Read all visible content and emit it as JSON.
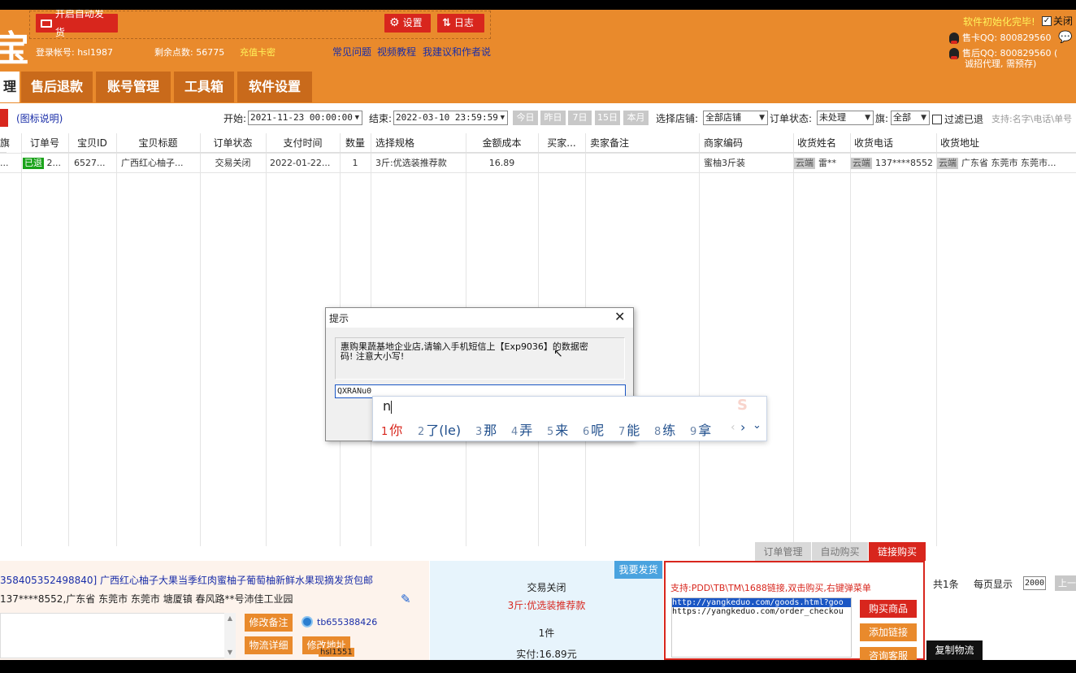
{
  "header": {
    "logo_char": "宝",
    "auto_ship_button": "开启自动发货",
    "settings_button": "设置",
    "log_button": "日志",
    "login_account": "登录帐号: hsl1987",
    "remaining_points": "剩余点数: 56775",
    "recharge_link": "充值卡密",
    "links": [
      "常见问题",
      "视频教程",
      "我建议和作者说"
    ],
    "init_done": "软件初始化完毕!",
    "close_checkbox_label": "关闭",
    "presale_qq": "售卡QQ: 800829560",
    "aftersale_qq": "售后QQ: 800829560 (",
    "aftersale_note": "诚招代理, 需预存)"
  },
  "tabs": [
    {
      "label": "理"
    },
    {
      "label": "售后退款"
    },
    {
      "label": "账号管理"
    },
    {
      "label": "工具箱"
    },
    {
      "label": "软件设置"
    }
  ],
  "filter": {
    "icon_legend": "(图标说明)",
    "start_label": "开始:",
    "start_value": "2021-11-23 00:00:00",
    "end_label": "结束:",
    "end_value": "2022-03-10 23:59:59",
    "quick_buttons": [
      "今日",
      "昨日",
      "7日",
      "15日",
      "本月"
    ],
    "shop_label": "选择店铺:",
    "shop_value": "全部店铺",
    "status_label": "订单状态:",
    "status_value": "未处理",
    "flag_label": "旗:",
    "flag_value": "全部",
    "filter_refunded_label": "过滤已退",
    "search_hint": "支持:名字\\电话\\单号"
  },
  "table": {
    "columns": [
      "旗",
      "订单号",
      "宝贝ID",
      "宝贝标题",
      "订单状态",
      "支付时间",
      "数量",
      "选择规格",
      "金额成本",
      "买家...",
      "卖家备注",
      "商家编码",
      "收货姓名",
      "收货电话",
      "收货地址"
    ],
    "rows": [
      {
        "flag": "...",
        "refund_tag": "已退",
        "order_no": "2...",
        "item_id": "6527...",
        "item_title": "广西红心柚子...",
        "status": "交易关闭",
        "pay_time": "2022-01-22...",
        "qty": "1",
        "spec": "3斤:优选装推荐款",
        "cost": "16.89",
        "buyer": "",
        "seller_note": "",
        "merchant_code": "蜜柚3斤装",
        "cloud_tag": "云端",
        "name": "雷**",
        "phone": "137****8552",
        "address": "广东省 东莞市 东莞市..."
      }
    ]
  },
  "dialog": {
    "title": "提示",
    "message_line1": "惠购果蔬基地企业店,请输入手机短信上【Exp9036】的数据密",
    "message_line2": "码! 注意大小写!",
    "input_value": "QXRANu0"
  },
  "ime": {
    "composition": "n",
    "candidates": [
      {
        "num": "1",
        "text": "你"
      },
      {
        "num": "2",
        "text": "了(le)"
      },
      {
        "num": "3",
        "text": "那"
      },
      {
        "num": "4",
        "text": "弄"
      },
      {
        "num": "5",
        "text": "来"
      },
      {
        "num": "6",
        "text": "呢"
      },
      {
        "num": "7",
        "text": "能"
      },
      {
        "num": "8",
        "text": "练"
      },
      {
        "num": "9",
        "text": "拿"
      }
    ],
    "prev": "‹",
    "next": "›",
    "expand": "⌄"
  },
  "bottom_tabs": [
    {
      "label": "订单管理"
    },
    {
      "label": "自动购买"
    },
    {
      "label": "链接购买"
    }
  ],
  "detail": {
    "title": "358405352498840] 广西红心柚子大果当季红肉蜜柚子葡萄柚新鲜水果现摘发货包邮",
    "address": "137****8552,广东省 东莞市 东莞市 塘厦镇 春风路**号沛佳工业园",
    "edit_note_button": "修改备注",
    "logistics_button": "物流详细",
    "modify_button": "修改地址",
    "wangwang_id": "tb655388426",
    "account_overlay": "hsl1551",
    "ship_button": "我要发货",
    "trade_status": "交易关闭",
    "spec": "3斤:优选装推荐款",
    "qty": "1件",
    "paid": "实付:16.89元"
  },
  "link_buy": {
    "support_text": "支持:PDD\\TB\\TM\\1688链接,双击购买,右键弹菜单",
    "urls": [
      "http://yangkeduo.com/goods.html?goo",
      "https://yangkeduo.com/order_checkou"
    ],
    "buy_button": "购买商品",
    "add_link_button": "添加链接",
    "consult_button": "咨询客服"
  },
  "pager": {
    "total": "共1条",
    "per_page_label": "每页显示",
    "per_page_value": "2000",
    "prev_button": "上一",
    "copy_logistics": "复制物流"
  },
  "colors": {
    "header_orange": "#e98a2c",
    "accent_red": "#d8261d",
    "ship_blue": "#4aa3df"
  }
}
